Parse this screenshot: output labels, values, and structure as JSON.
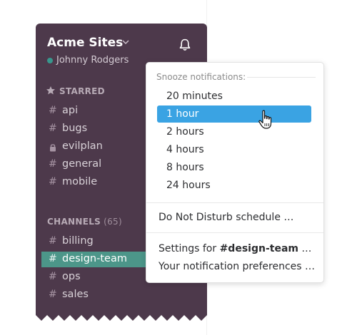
{
  "sidebar": {
    "team_name": "Acme Sites",
    "user_name": "Johnny Rodgers",
    "presence": "active",
    "starred_header": "STARRED",
    "starred": [
      {
        "prefix": "#",
        "name": "api"
      },
      {
        "prefix": "#",
        "name": "bugs"
      },
      {
        "prefix": "lock-icon",
        "name": "evilplan"
      },
      {
        "prefix": "#",
        "name": "general"
      },
      {
        "prefix": "#",
        "name": "mobile"
      }
    ],
    "channels_header": "CHANNELS",
    "channels_count": "(65)",
    "channels": [
      {
        "prefix": "#",
        "name": "billing"
      },
      {
        "prefix": "#",
        "name": "design-team",
        "active": true
      },
      {
        "prefix": "#",
        "name": "ops"
      },
      {
        "prefix": "#",
        "name": "sales"
      }
    ]
  },
  "menu": {
    "label": "Snooze notifications:",
    "snooze_options": [
      "20 minutes",
      "1 hour",
      "2 hours",
      "4 hours",
      "8 hours",
      "24 hours"
    ],
    "selected": "1 hour",
    "dnd_schedule": "Do Not Disturb schedule …",
    "settings_prefix": "Settings for ",
    "settings_channel": "#design-team",
    "settings_suffix": " …",
    "preferences": "Your notification preferences …"
  },
  "colors": {
    "sidebar_bg": "#4d394b",
    "active_channel": "#4c9689",
    "selected_item": "#3aa3e3",
    "presence": "#38978d"
  }
}
